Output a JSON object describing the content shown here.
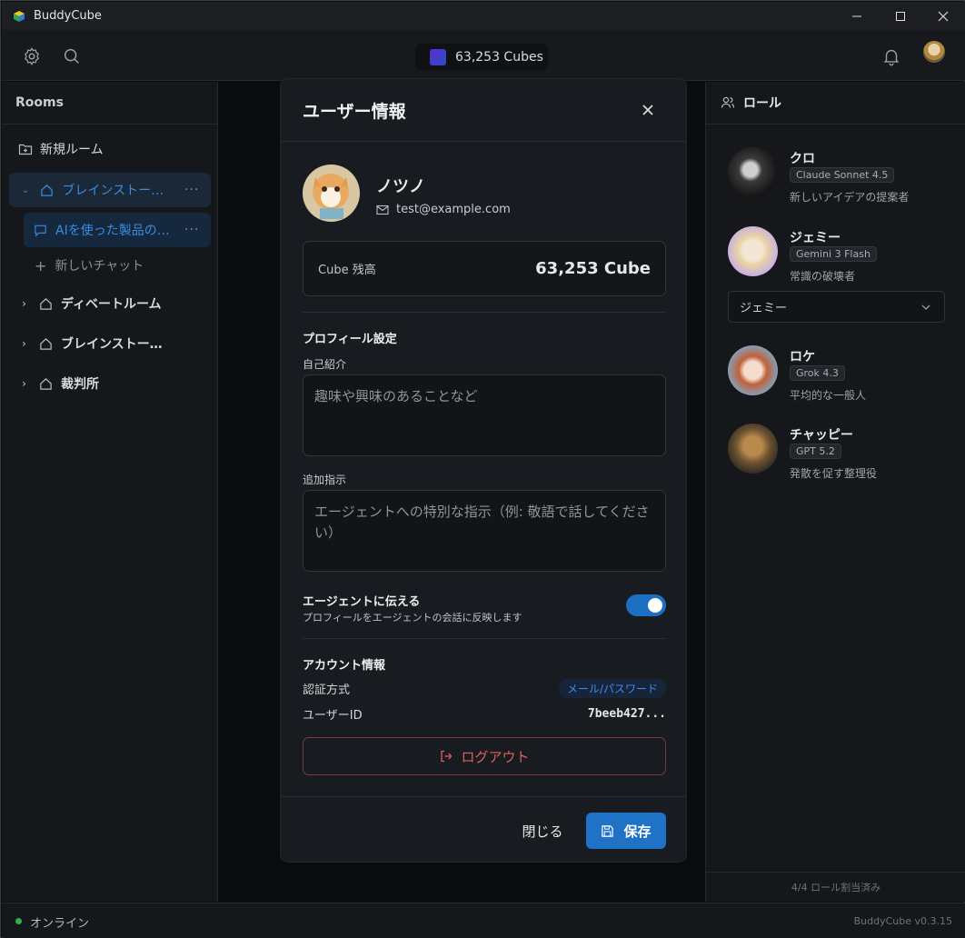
{
  "window": {
    "title": "BuddyCube"
  },
  "toolbar": {
    "cubes": "63,253 Cubes"
  },
  "sidebar": {
    "title": "Rooms",
    "new_room": "新規ルーム",
    "rooms": [
      {
        "label": "ブレインストー…",
        "active": true
      },
      {
        "label": "ディベートルーム"
      },
      {
        "label": "ブレインストー…"
      },
      {
        "label": "裁判所"
      }
    ],
    "active_chat": "AIを使った製品の…",
    "new_chat": "新しいチャット"
  },
  "roles_panel": {
    "title": "ロール",
    "roles": [
      {
        "name": "クロ",
        "model": "Claude Sonnet 4.5",
        "desc": "新しいアイデアの提案者"
      },
      {
        "name": "ジェミー",
        "model": "Gemini 3 Flash",
        "desc": "常識の破壊者"
      },
      {
        "name": "ロケ",
        "model": "Grok 4.3",
        "desc": "平均的な一般人"
      },
      {
        "name": "チャッピー",
        "model": "GPT 5.2",
        "desc": "発散を促す整理役"
      }
    ],
    "select_value": "ジェミー",
    "footer": "4/4 ロール割当済み"
  },
  "statusbar": {
    "status": "オンライン",
    "version": "BuddyCube v0.3.15"
  },
  "modal": {
    "title": "ユーザー情報",
    "user_name": "ノツノ",
    "email": "test@example.com",
    "balance_label": "Cube 残高",
    "balance_value": "63,253 Cube",
    "profile_title": "プロフィール設定",
    "bio_label": "自己紹介",
    "bio_placeholder": "趣味や興味のあることなど",
    "instr_label": "追加指示",
    "instr_placeholder": "エージェントへの特別な指示（例: 敬語で話してください）",
    "toggle_label": "エージェントに伝える",
    "toggle_desc": "プロフィールをエージェントの会話に反映します",
    "toggle_on": true,
    "account_title": "アカウント情報",
    "auth_label": "認証方式",
    "auth_value": "メール/パスワード",
    "uid_label": "ユーザーID",
    "uid_value": "7beeb427...",
    "logout": "ログアウト",
    "close": "閉じる",
    "save": "保存"
  },
  "colors": {
    "accent": "#1f72c5",
    "danger": "#e0605c",
    "online": "#2fb34a"
  }
}
